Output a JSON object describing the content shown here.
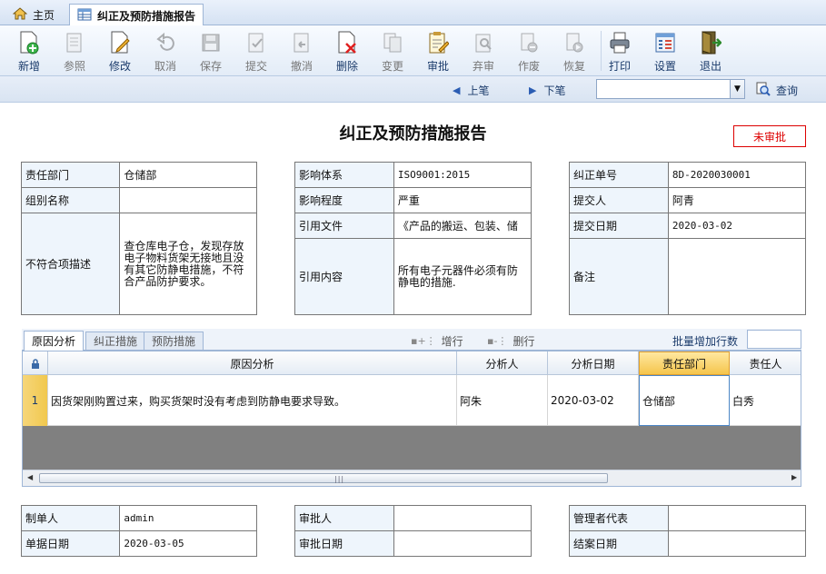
{
  "tabs": {
    "home": "主页",
    "active": "纠正及预防措施报告"
  },
  "toolbar": {
    "items": [
      {
        "label": "新增",
        "icon": "add-icon",
        "enabled": true
      },
      {
        "label": "参照",
        "icon": "reference-icon",
        "enabled": false
      },
      {
        "label": "修改",
        "icon": "edit-icon",
        "enabled": true
      },
      {
        "label": "取消",
        "icon": "cancel-icon",
        "enabled": false
      },
      {
        "label": "保存",
        "icon": "save-icon",
        "enabled": false
      },
      {
        "label": "提交",
        "icon": "submit-icon",
        "enabled": false
      },
      {
        "label": "撤消",
        "icon": "undo-icon",
        "enabled": false
      },
      {
        "label": "删除",
        "icon": "delete-icon",
        "enabled": true
      },
      {
        "label": "变更",
        "icon": "change-icon",
        "enabled": false
      },
      {
        "label": "审批",
        "icon": "approve-icon",
        "enabled": true
      },
      {
        "label": "弃审",
        "icon": "unapprove-icon",
        "enabled": false
      },
      {
        "label": "作废",
        "icon": "void-icon",
        "enabled": false
      },
      {
        "label": "恢复",
        "icon": "restore-icon",
        "enabled": false
      },
      {
        "label": "打印",
        "icon": "printer-icon",
        "enabled": true
      },
      {
        "label": "设置",
        "icon": "settings-icon",
        "enabled": true
      },
      {
        "label": "退出",
        "icon": "exit-icon",
        "enabled": true
      }
    ]
  },
  "nav": {
    "prev": "上笔",
    "next": "下笔",
    "select_value": "",
    "query": "查询"
  },
  "form": {
    "title": "纠正及预防措施报告",
    "status": "未审批",
    "left": {
      "dept_label": "责任部门",
      "dept_value": "仓储部",
      "group_label": "组别名称",
      "group_value": "",
      "desc_label": "不符合项描述",
      "desc_value": "查仓库电子仓，发现存放电子物料货架无接地且没有其它防静电措施，不符合产品防护要求。"
    },
    "middle": {
      "system_label": "影响体系",
      "system_value": "ISO9001:2015",
      "degree_label": "影响程度",
      "degree_value": "严重",
      "file_label": "引用文件",
      "file_value": "《产品的搬运、包装、储",
      "content_label": "引用内容",
      "content_value": "所有电子元器件必须有防静电的措施."
    },
    "right": {
      "no_label": "纠正单号",
      "no_value": "8D-2020030001",
      "submitter_label": "提交人",
      "submitter_value": "阿青",
      "date_label": "提交日期",
      "date_value": "2020-03-02",
      "remark_label": "备注",
      "remark_value": ""
    }
  },
  "detail": {
    "tabs": [
      "原因分析",
      "纠正措施",
      "预防措施"
    ],
    "add_row": "增行",
    "del_row": "删行",
    "batch_label": "批量增加行数",
    "batch_value": "",
    "columns": [
      "原因分析",
      "分析人",
      "分析日期",
      "责任部门",
      "责任人"
    ],
    "rows": [
      {
        "no": "1",
        "cause": "因货架刚购置过来，购买货架时没有考虑到防静电要求导致。",
        "analyst": "阿朱",
        "date": "2020-03-02",
        "dept": "仓储部",
        "owner": "白秀"
      }
    ]
  },
  "footer": {
    "maker_label": "制单人",
    "maker_value": "admin",
    "make_date_label": "单据日期",
    "make_date_value": "2020-03-05",
    "approver_label": "审批人",
    "approver_value": "",
    "approve_date_label": "审批日期",
    "approve_date_value": "",
    "manager_label": "管理者代表",
    "manager_value": "",
    "close_date_label": "结案日期",
    "close_date_value": ""
  }
}
